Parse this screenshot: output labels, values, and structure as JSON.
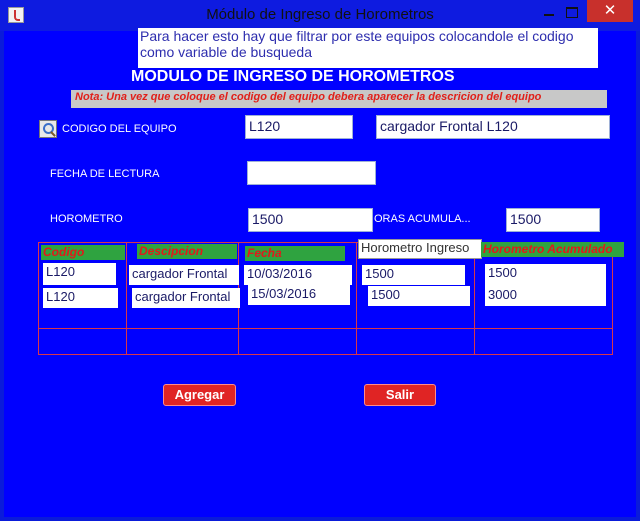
{
  "window": {
    "title": "Módulo de Ingreso de Horometros",
    "close_glyph": "✕"
  },
  "note": {
    "text_line1": "Para hacer esto hay que filtrar por este equipos colocandole el codigo",
    "text_line2": "como variable de busqueda"
  },
  "heading": "MODULO DE INGRESO DE HOROMETROS",
  "warning": "Nota: Una vez que coloque el codigo del equipo debera aparecer la descricion del equipo",
  "form": {
    "codigo_label": "CODIGO DEL EQUIPO",
    "codigo_value": "L120",
    "descripcion_value": "cargador Frontal L120",
    "fecha_label": "FECHA DE LECTURA",
    "fecha_value": "",
    "horometro_label": "HOROMETRO",
    "horometro_value": "1500",
    "acumulado_label": "ORAS ACUMULA...",
    "acumulado_value": "1500"
  },
  "table": {
    "headers": [
      "Codigo",
      "Descipcion",
      "Fecha",
      "Horometro Ingreso",
      "Horometro Acumulado"
    ],
    "rows": [
      [
        "L120",
        "cargador Frontal",
        "10/03/2016",
        "1500",
        "1500"
      ],
      [
        "L120",
        "cargador Frontal",
        "15/03/2016",
        "1500",
        "3000"
      ]
    ]
  },
  "buttons": {
    "agregar": "Agregar",
    "salir": "Salir"
  },
  "colors": {
    "background": "#0000ff",
    "header_green": "#2fa340",
    "button_red": "#e02424",
    "grid_red": "#d7374a"
  }
}
